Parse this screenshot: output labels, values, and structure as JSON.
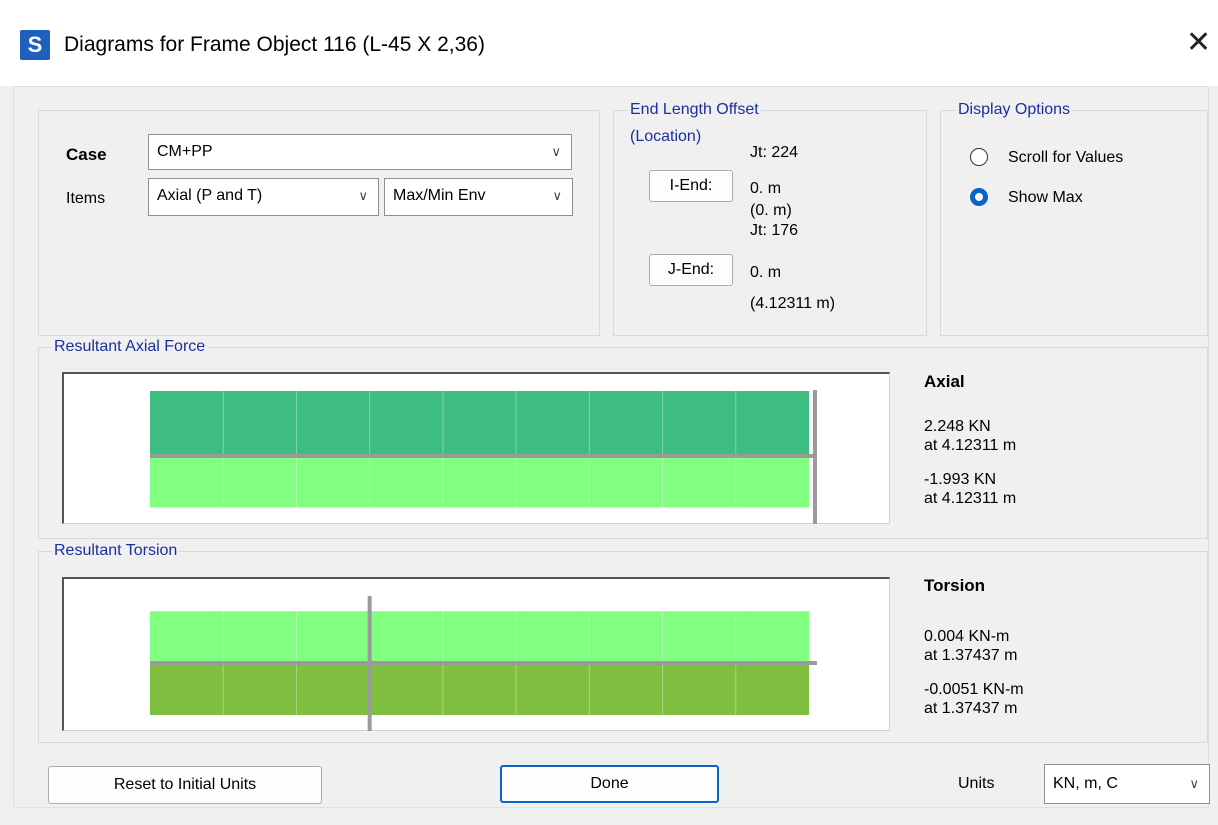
{
  "window": {
    "app_icon_letter": "S",
    "title": "Diagrams for Frame Object 116  (L-45 X 2,36)",
    "close_glyph": "✕"
  },
  "case_section": {
    "case_label": "Case",
    "case_value": "CM+PP",
    "items_label": "Items",
    "items_value": "Axial (P and T)",
    "env_value": "Max/Min Env"
  },
  "end_length_offset": {
    "title_line1": "End Length Offset",
    "title_line2": "(Location)",
    "i_end_button": "I-End:",
    "j_end_button": "J-End:",
    "i_joint": "Jt:  224",
    "i_offset": "0. m",
    "i_location": "(0. m)",
    "j_joint": "Jt:  176",
    "j_offset": "0. m",
    "j_location": "(4.12311 m)"
  },
  "display_options": {
    "title": "Display Options",
    "scroll_label": "Scroll for Values",
    "show_max_label": "Show Max",
    "selected": "Show Max"
  },
  "axial_panel": {
    "title": "Resultant Axial Force",
    "heading": "Axial",
    "max_value": "2.248 KN",
    "max_location": "at 4.12311 m",
    "min_value": "-1.993 KN",
    "min_location": "at 4.12311 m",
    "colors": {
      "positive": "#3dbd80",
      "negative": "#80ff80"
    }
  },
  "torsion_panel": {
    "title": "Resultant Torsion",
    "heading": "Torsion",
    "max_value": "0.004 KN-m",
    "max_location": "at 1.37437 m",
    "min_value": "-0.0051 KN-m",
    "min_location": "at 1.37437 m",
    "colors": {
      "positive": "#80ff80",
      "negative": "#7fbf3f"
    }
  },
  "footer": {
    "reset_button": "Reset to Initial Units",
    "done_button": "Done",
    "units_label": "Units",
    "units_value": "KN, m, C"
  },
  "chart_data": [
    {
      "type": "area",
      "title": "Resultant Axial Force",
      "x_range_m": [
        0,
        4.12311
      ],
      "series": [
        {
          "name": "",
          "values": [
            2.248,
            2.248
          ]
        },
        {
          "name": "",
          "values": [
            -1.993,
            -1.993
          ]
        }
      ],
      "marker_at_m": 4.12311
    },
    {
      "type": "area",
      "title": "Resultant Torsion",
      "x_range_m": [
        0,
        4.12311
      ],
      "series": [
        {
          "name": "",
          "values": [
            0.004,
            0.004
          ]
        },
        {
          "name": "",
          "values": [
            -0.0051,
            -0.0051
          ]
        }
      ],
      "marker_at_m": 1.37437
    }
  ]
}
